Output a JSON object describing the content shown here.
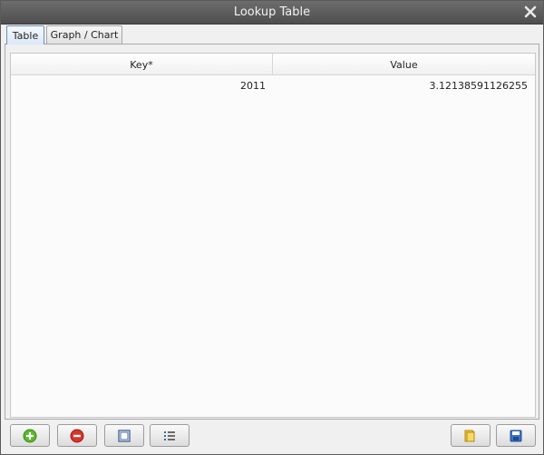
{
  "window": {
    "title": "Lookup Table"
  },
  "tabs": [
    {
      "label": "Table",
      "active": true
    },
    {
      "label": "Graph / Chart",
      "active": false
    }
  ],
  "table": {
    "columns": [
      "Key*",
      "Value"
    ],
    "rows": [
      {
        "key": "2011",
        "value": "3.12138591126255"
      }
    ]
  },
  "toolbar": {
    "buttons": [
      {
        "icon": "add-icon"
      },
      {
        "icon": "remove-icon"
      },
      {
        "icon": "window-icon"
      },
      {
        "icon": "list-icon"
      },
      {
        "icon": "folder-icon"
      },
      {
        "icon": "save-icon"
      }
    ]
  },
  "colors": {
    "titlebar": "#5a5a5a",
    "active_tab": "#dbe8f6",
    "add_green": "#5cb82e",
    "remove_red": "#d9342b"
  }
}
